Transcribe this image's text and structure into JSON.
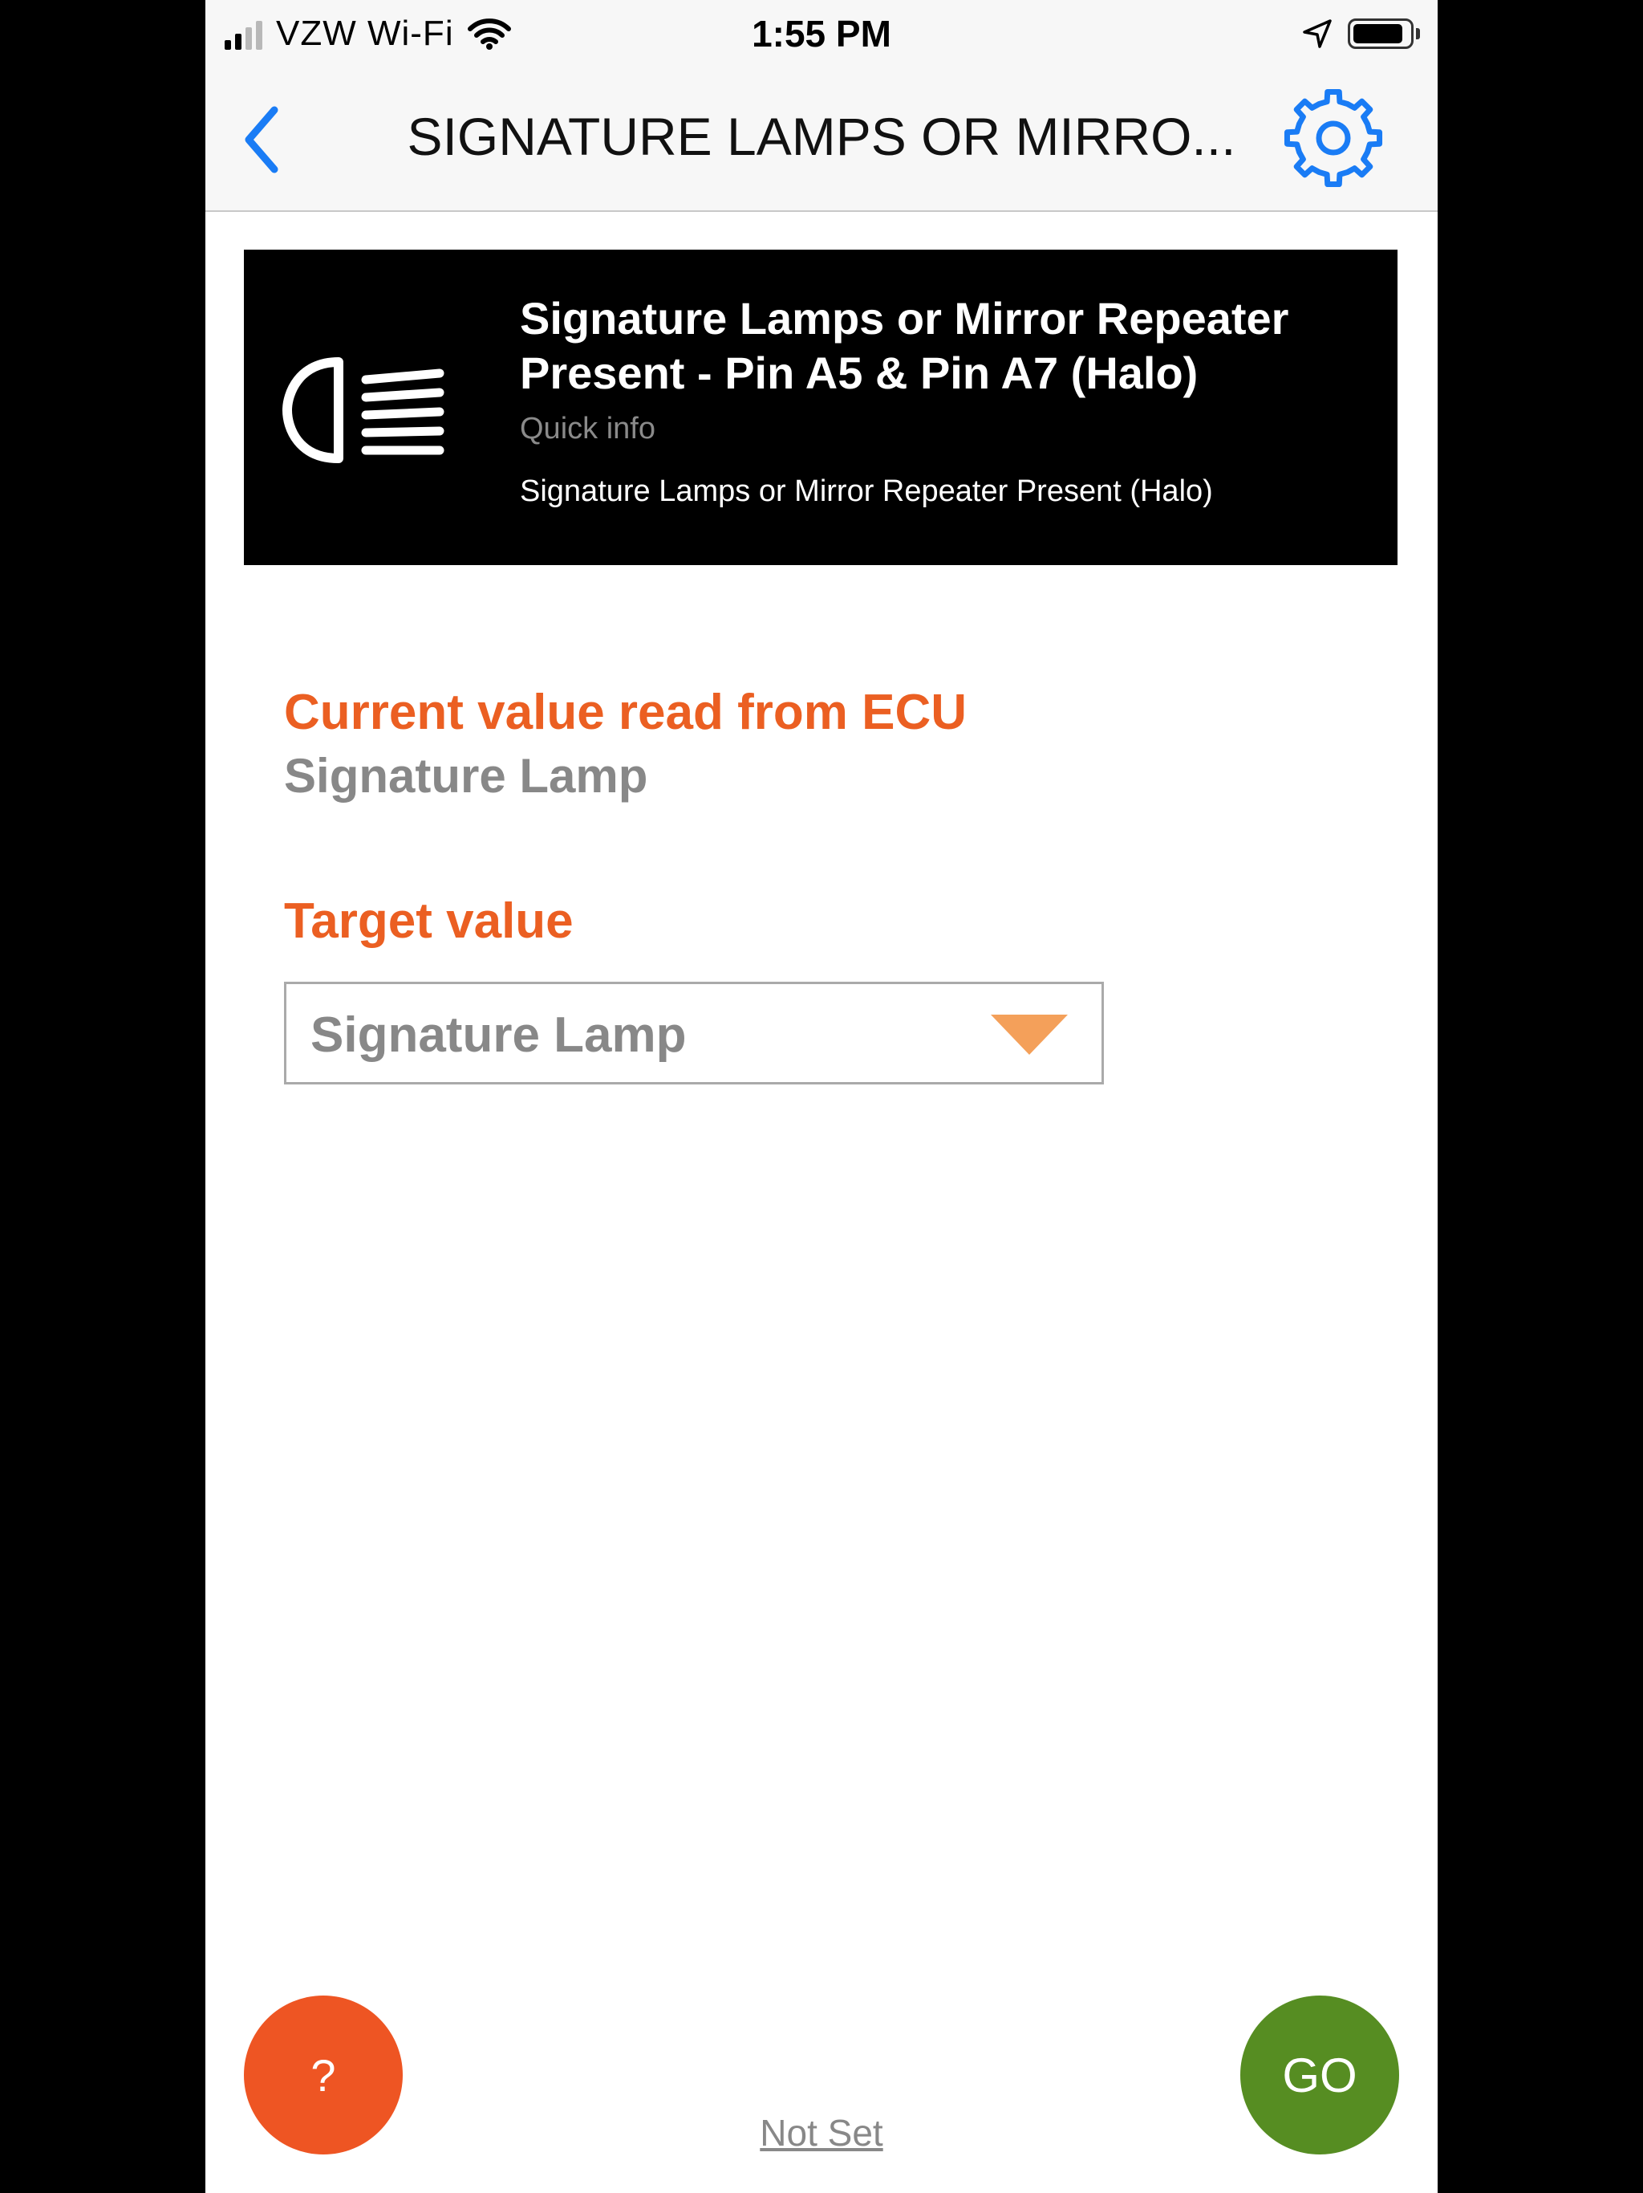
{
  "status_bar": {
    "carrier": "VZW Wi-Fi",
    "time": "1:55 PM",
    "battery_level": 0.9,
    "signal_bars_active": 2,
    "signal_bars_total": 4
  },
  "nav": {
    "title": "SIGNATURE LAMPS OR MIRRO...",
    "back_icon": "chevron-left-icon",
    "settings_icon": "gear-icon",
    "accent_color": "#1a7cf5"
  },
  "info_card": {
    "icon": "headlamp-icon",
    "title": "Signature Lamps or Mirror Repeater Present - Pin A5 & Pin A7 (Halo)",
    "subtitle": "Quick info",
    "description": "Signature Lamps or Mirror Repeater Present (Halo)"
  },
  "current": {
    "label": "Current value read from ECU",
    "value": "Signature Lamp"
  },
  "target": {
    "label": "Target value",
    "selected": "Signature Lamp"
  },
  "footer": {
    "help_label": "?",
    "go_label": "GO",
    "not_set_label": "Not Set"
  },
  "colors": {
    "orange_label": "#eb5f22",
    "help_button": "#ee5523",
    "go_button": "#568d22",
    "dropdown_arrow": "#f4a05a"
  }
}
